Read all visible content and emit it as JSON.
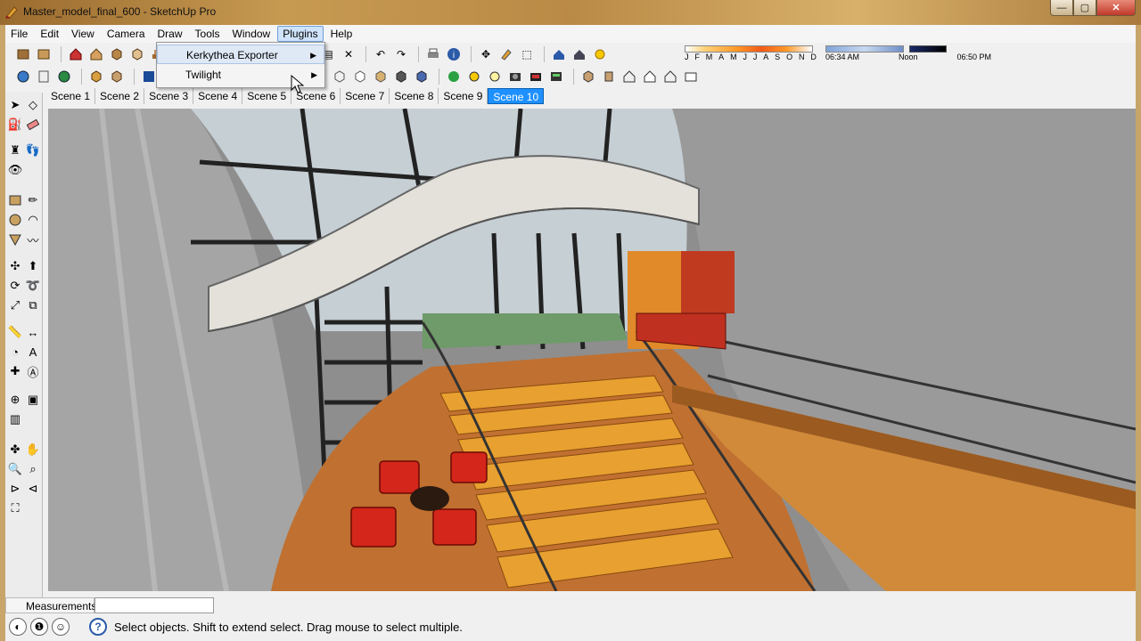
{
  "window": {
    "title": "Master_model_final_600 - SketchUp Pro"
  },
  "menubar": {
    "items": [
      "File",
      "Edit",
      "View",
      "Camera",
      "Draw",
      "Tools",
      "Window",
      "Plugins",
      "Help"
    ],
    "active": "Plugins"
  },
  "plugins_menu": {
    "items": [
      {
        "label": "Kerkythea Exporter",
        "has_submenu": true
      },
      {
        "label": "Twilight",
        "has_submenu": true
      }
    ]
  },
  "shadow_settings": {
    "months": [
      "J",
      "F",
      "M",
      "A",
      "M",
      "J",
      "J",
      "A",
      "S",
      "O",
      "N",
      "D"
    ],
    "time_start": "06:34 AM",
    "time_mid": "Noon",
    "time_end": "06:50 PM"
  },
  "scenes": {
    "tabs": [
      "Scene 1",
      "Scene 2",
      "Scene 3",
      "Scene 4",
      "Scene 5",
      "Scene 6",
      "Scene 7",
      "Scene 8",
      "Scene 9",
      "Scene 10"
    ],
    "active": "Scene 10"
  },
  "measurements": {
    "label": "Measurements",
    "value": ""
  },
  "status": {
    "text": "Select objects. Shift to extend select. Drag mouse to select multiple."
  },
  "colors": {
    "accent": "#1e90ff",
    "menu_active": "#cfe3fb"
  }
}
